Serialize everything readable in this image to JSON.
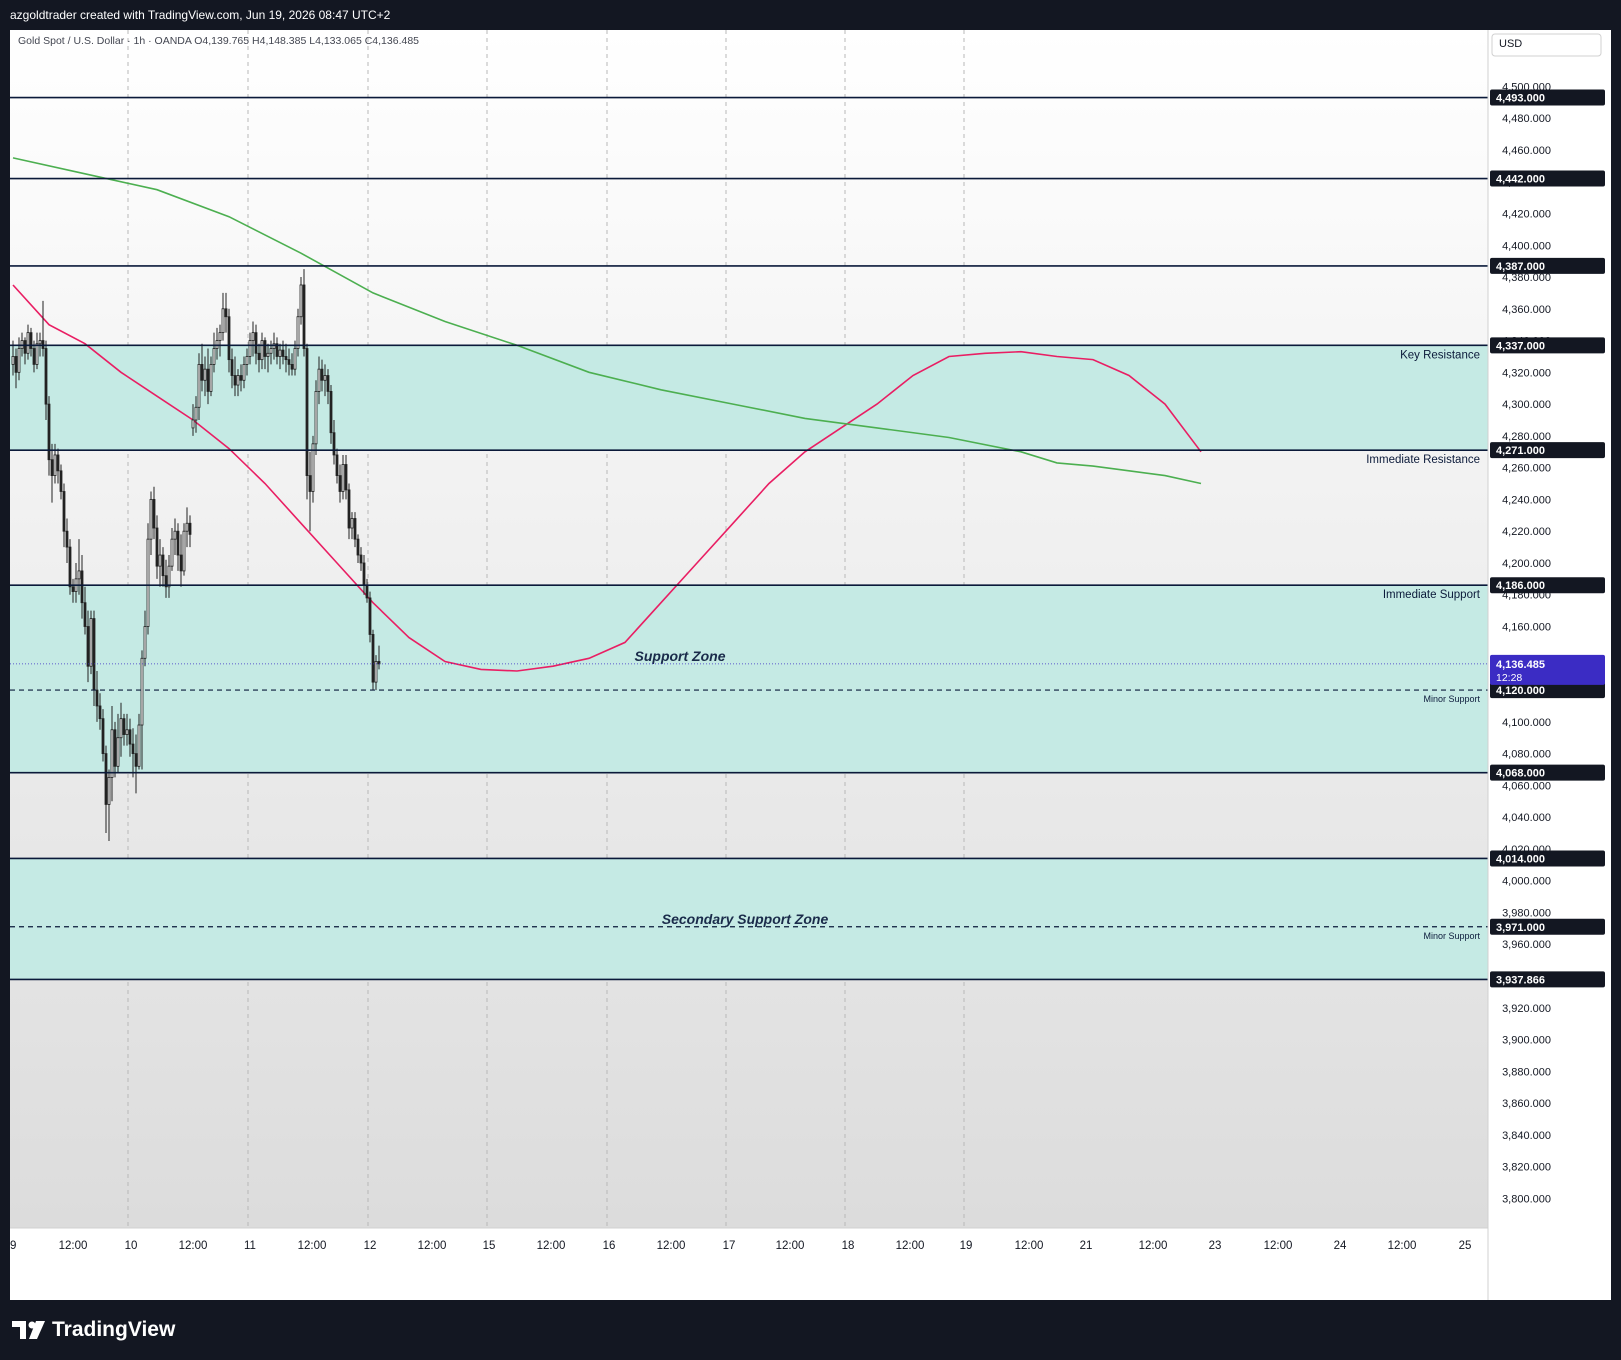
{
  "header": {
    "attribution": "azgoldtrader created with TradingView.com, Jun 19, 2026 08:47 UTC+2"
  },
  "brand": {
    "name": "TradingView"
  },
  "chart_data": {
    "type": "candlestick",
    "legend_text": "Gold Spot / U.S. Dollar · 1h · OANDA  O4,139.765  H4,148.385  L4,133.065  C4,136.485",
    "currency": "USD",
    "ylim": [
      3780,
      4535
    ],
    "y_ticks": [
      3800,
      3820,
      3840,
      3860,
      3880,
      3900,
      3920,
      3940,
      3960,
      3980,
      4000,
      4020,
      4040,
      4060,
      4080,
      4100,
      4120,
      4140,
      4160,
      4180,
      4200,
      4220,
      4240,
      4260,
      4280,
      4300,
      4320,
      4340,
      4360,
      4380,
      4400,
      4420,
      4440,
      4460,
      4480,
      4500
    ],
    "x_ticks": [
      "9",
      "12:00",
      "10",
      "12:00",
      "11",
      "12:00",
      "12",
      "12:00",
      "15",
      "12:00",
      "16",
      "12:00",
      "17",
      "12:00",
      "18",
      "12:00",
      "19",
      "12:00",
      "21",
      "12:00",
      "23",
      "12:00",
      "24",
      "12:00",
      "25"
    ],
    "price_marker": {
      "value": "4,136.485",
      "countdown": "12:28",
      "color": "#3b2cc4"
    },
    "levels": [
      {
        "price": 4537,
        "label": "",
        "axis": ""
      },
      {
        "price": 4493,
        "label": "",
        "axis": "4,493.000"
      },
      {
        "price": 4442,
        "label": "",
        "axis": "4,442.000"
      },
      {
        "price": 4387,
        "label": "",
        "axis": "4,387.000"
      },
      {
        "price": 4337,
        "label": "Key Resistance",
        "axis": "4,337.000"
      },
      {
        "price": 4271,
        "label": "Immediate Resistance",
        "axis": "4,271.000"
      },
      {
        "price": 4186,
        "label": "Immediate Support",
        "axis": "4,186.000"
      },
      {
        "price": 4068,
        "label": "",
        "axis": "4,068.000"
      },
      {
        "price": 4014,
        "label": "",
        "axis": "4,014.000"
      },
      {
        "price": 3937.866,
        "label": "",
        "axis": "3,937.866"
      }
    ],
    "dashed_levels": [
      {
        "price": 4120,
        "label": "Minor Support",
        "axis": "4,120.000"
      },
      {
        "price": 3971,
        "label": "Minor Support",
        "axis": "3,971.000"
      }
    ],
    "zones": [
      {
        "from": 4271,
        "to": 4337,
        "label": "",
        "color": "#c5eae4"
      },
      {
        "from": 4068,
        "to": 4186,
        "label": "Support Zone",
        "color": "#c5eae4"
      },
      {
        "from": 3937.866,
        "to": 4014,
        "label": "Secondary Support Zone",
        "color": "#c5eae4"
      }
    ],
    "series": [
      {
        "type": "moving_average",
        "color": "#e91e63",
        "points": [
          [
            0,
            4375
          ],
          [
            12,
            4350
          ],
          [
            24,
            4338
          ],
          [
            36,
            4320
          ],
          [
            48,
            4305
          ],
          [
            60,
            4290
          ],
          [
            72,
            4272
          ],
          [
            84,
            4250
          ],
          [
            96,
            4225
          ],
          [
            108,
            4200
          ],
          [
            120,
            4175
          ],
          [
            132,
            4153
          ],
          [
            144,
            4138
          ],
          [
            156,
            4133
          ],
          [
            168,
            4132
          ],
          [
            180,
            4135
          ],
          [
            192,
            4140
          ],
          [
            204,
            4150
          ],
          [
            216,
            4175
          ],
          [
            228,
            4200
          ],
          [
            240,
            4225
          ],
          [
            252,
            4250
          ],
          [
            264,
            4270
          ],
          [
            276,
            4285
          ],
          [
            288,
            4300
          ],
          [
            300,
            4318
          ],
          [
            312,
            4330
          ],
          [
            324,
            4332
          ],
          [
            336,
            4333
          ],
          [
            348,
            4330
          ],
          [
            360,
            4328
          ],
          [
            372,
            4318
          ],
          [
            384,
            4300
          ],
          [
            396,
            4270
          ]
        ]
      },
      {
        "type": "moving_average",
        "color": "#4caf50",
        "points": [
          [
            0,
            4455
          ],
          [
            24,
            4445
          ],
          [
            48,
            4435
          ],
          [
            72,
            4418
          ],
          [
            96,
            4395
          ],
          [
            120,
            4370
          ],
          [
            144,
            4352
          ],
          [
            168,
            4337
          ],
          [
            192,
            4320
          ],
          [
            216,
            4309
          ],
          [
            240,
            4300
          ],
          [
            264,
            4291
          ],
          [
            288,
            4285
          ],
          [
            312,
            4279
          ],
          [
            336,
            4270
          ],
          [
            348,
            4263
          ],
          [
            360,
            4261
          ],
          [
            372,
            4258
          ],
          [
            384,
            4255
          ],
          [
            396,
            4250
          ]
        ]
      }
    ],
    "candles": [
      [
        4325,
        4340,
        4318,
        4330
      ],
      [
        4330,
        4335,
        4310,
        4320
      ],
      [
        4320,
        4342,
        4315,
        4335
      ],
      [
        4335,
        4345,
        4330,
        4340
      ],
      [
        4340,
        4342,
        4325,
        4332
      ],
      [
        4332,
        4350,
        4328,
        4345
      ],
      [
        4345,
        4348,
        4330,
        4335
      ],
      [
        4335,
        4340,
        4320,
        4325
      ],
      [
        4325,
        4345,
        4322,
        4338
      ],
      [
        4338,
        4345,
        4330,
        4340
      ],
      [
        4340,
        4365,
        4330,
        4335
      ],
      [
        4335,
        4340,
        4290,
        4300
      ],
      [
        4300,
        4305,
        4255,
        4265
      ],
      [
        4265,
        4275,
        4238,
        4255
      ],
      [
        4255,
        4275,
        4250,
        4268
      ],
      [
        4268,
        4272,
        4250,
        4258
      ],
      [
        4258,
        4262,
        4240,
        4245
      ],
      [
        4245,
        4250,
        4210,
        4220
      ],
      [
        4220,
        4228,
        4200,
        4210
      ],
      [
        4210,
        4215,
        4180,
        4185
      ],
      [
        4185,
        4190,
        4175,
        4182
      ],
      [
        4182,
        4200,
        4175,
        4190
      ],
      [
        4190,
        4215,
        4180,
        4195
      ],
      [
        4195,
        4205,
        4165,
        4175
      ],
      [
        4175,
        4185,
        4155,
        4160
      ],
      [
        4160,
        4170,
        4125,
        4135
      ],
      [
        4135,
        4170,
        4130,
        4165
      ],
      [
        4165,
        4170,
        4110,
        4120
      ],
      [
        4120,
        4132,
        4100,
        4110
      ],
      [
        4110,
        4118,
        4095,
        4102
      ],
      [
        4102,
        4108,
        4075,
        4080
      ],
      [
        4080,
        4085,
        4030,
        4048
      ],
      [
        4048,
        4070,
        4025,
        4065
      ],
      [
        4065,
        4110,
        4050,
        4095
      ],
      [
        4095,
        4100,
        4065,
        4072
      ],
      [
        4072,
        4105,
        4068,
        4090
      ],
      [
        4090,
        4112,
        4078,
        4102
      ],
      [
        4102,
        4105,
        4085,
        4092
      ],
      [
        4092,
        4105,
        4085,
        4095
      ],
      [
        4095,
        4102,
        4078,
        4086
      ],
      [
        4086,
        4096,
        4065,
        4080
      ],
      [
        4080,
        4092,
        4055,
        4072
      ],
      [
        4072,
        4105,
        4070,
        4098
      ],
      [
        4098,
        4145,
        4070,
        4140
      ],
      [
        4140,
        4170,
        4135,
        4160
      ],
      [
        4160,
        4225,
        4155,
        4215
      ],
      [
        4215,
        4245,
        4205,
        4240
      ],
      [
        4240,
        4248,
        4215,
        4222
      ],
      [
        4222,
        4230,
        4190,
        4198
      ],
      [
        4198,
        4215,
        4185,
        4205
      ],
      [
        4205,
        4210,
        4185,
        4192
      ],
      [
        4192,
        4202,
        4178,
        4185
      ],
      [
        4185,
        4205,
        4178,
        4198
      ],
      [
        4198,
        4222,
        4195,
        4215
      ],
      [
        4215,
        4228,
        4205,
        4220
      ],
      [
        4220,
        4225,
        4195,
        4205
      ],
      [
        4205,
        4218,
        4185,
        4195
      ],
      [
        4195,
        4225,
        4192,
        4220
      ],
      [
        4220,
        4235,
        4210,
        4225
      ],
      [
        4225,
        4230,
        4210,
        4218
      ],
      [
        4285,
        4300,
        4280,
        4290
      ],
      [
        4290,
        4305,
        4282,
        4298
      ],
      [
        4298,
        4332,
        4290,
        4325
      ],
      [
        4325,
        4338,
        4308,
        4315
      ],
      [
        4315,
        4330,
        4305,
        4322
      ],
      [
        4322,
        4335,
        4300,
        4308
      ],
      [
        4308,
        4330,
        4305,
        4325
      ],
      [
        4325,
        4345,
        4320,
        4335
      ],
      [
        4335,
        4348,
        4328,
        4340
      ],
      [
        4340,
        4350,
        4330,
        4345
      ],
      [
        4345,
        4370,
        4340,
        4360
      ],
      [
        4360,
        4370,
        4345,
        4355
      ],
      [
        4355,
        4360,
        4320,
        4328
      ],
      [
        4328,
        4335,
        4310,
        4318
      ],
      [
        4318,
        4330,
        4305,
        4312
      ],
      [
        4312,
        4322,
        4305,
        4318
      ],
      [
        4318,
        4325,
        4308,
        4315
      ],
      [
        4315,
        4330,
        4310,
        4325
      ],
      [
        4325,
        4335,
        4318,
        4330
      ],
      [
        4330,
        4345,
        4325,
        4340
      ],
      [
        4340,
        4352,
        4330,
        4345
      ],
      [
        4345,
        4350,
        4325,
        4332
      ],
      [
        4332,
        4338,
        4320,
        4328
      ],
      [
        4328,
        4345,
        4322,
        4340
      ],
      [
        4340,
        4342,
        4322,
        4330
      ],
      [
        4330,
        4338,
        4320,
        4332
      ],
      [
        4332,
        4340,
        4325,
        4335
      ],
      [
        4335,
        4345,
        4328,
        4338
      ],
      [
        4338,
        4342,
        4325,
        4330
      ],
      [
        4330,
        4338,
        4322,
        4334
      ],
      [
        4334,
        4340,
        4325,
        4330
      ],
      [
        4330,
        4338,
        4320,
        4328
      ],
      [
        4328,
        4335,
        4318,
        4325
      ],
      [
        4325,
        4332,
        4318,
        4322
      ],
      [
        4322,
        4340,
        4318,
        4335
      ],
      [
        4335,
        4360,
        4330,
        4355
      ],
      [
        4355,
        4380,
        4350,
        4375
      ],
      [
        4375,
        4385,
        4330,
        4335
      ],
      [
        4335,
        4338,
        4240,
        4255
      ],
      [
        4255,
        4270,
        4220,
        4245
      ],
      [
        4245,
        4280,
        4238,
        4275
      ],
      [
        4275,
        4315,
        4268,
        4308
      ],
      [
        4308,
        4330,
        4300,
        4322
      ],
      [
        4322,
        4328,
        4308,
        4315
      ],
      [
        4315,
        4325,
        4305,
        4318
      ],
      [
        4318,
        4322,
        4300,
        4308
      ],
      [
        4308,
        4312,
        4275,
        4282
      ],
      [
        4282,
        4290,
        4262,
        4268
      ],
      [
        4268,
        4272,
        4250,
        4255
      ],
      [
        4255,
        4262,
        4238,
        4245
      ],
      [
        4245,
        4268,
        4240,
        4262
      ],
      [
        4262,
        4268,
        4240,
        4246
      ],
      [
        4246,
        4250,
        4215,
        4222
      ],
      [
        4222,
        4232,
        4215,
        4228
      ],
      [
        4228,
        4232,
        4210,
        4215
      ],
      [
        4215,
        4218,
        4200,
        4205
      ],
      [
        4205,
        4210,
        4195,
        4200
      ],
      [
        4200,
        4205,
        4180,
        4186
      ],
      [
        4186,
        4190,
        4175,
        4178
      ],
      [
        4178,
        4182,
        4150,
        4155
      ],
      [
        4155,
        4158,
        4120,
        4125
      ],
      [
        4125,
        4142,
        4120,
        4138
      ],
      [
        4138,
        4148,
        4133,
        4136.485
      ]
    ]
  }
}
